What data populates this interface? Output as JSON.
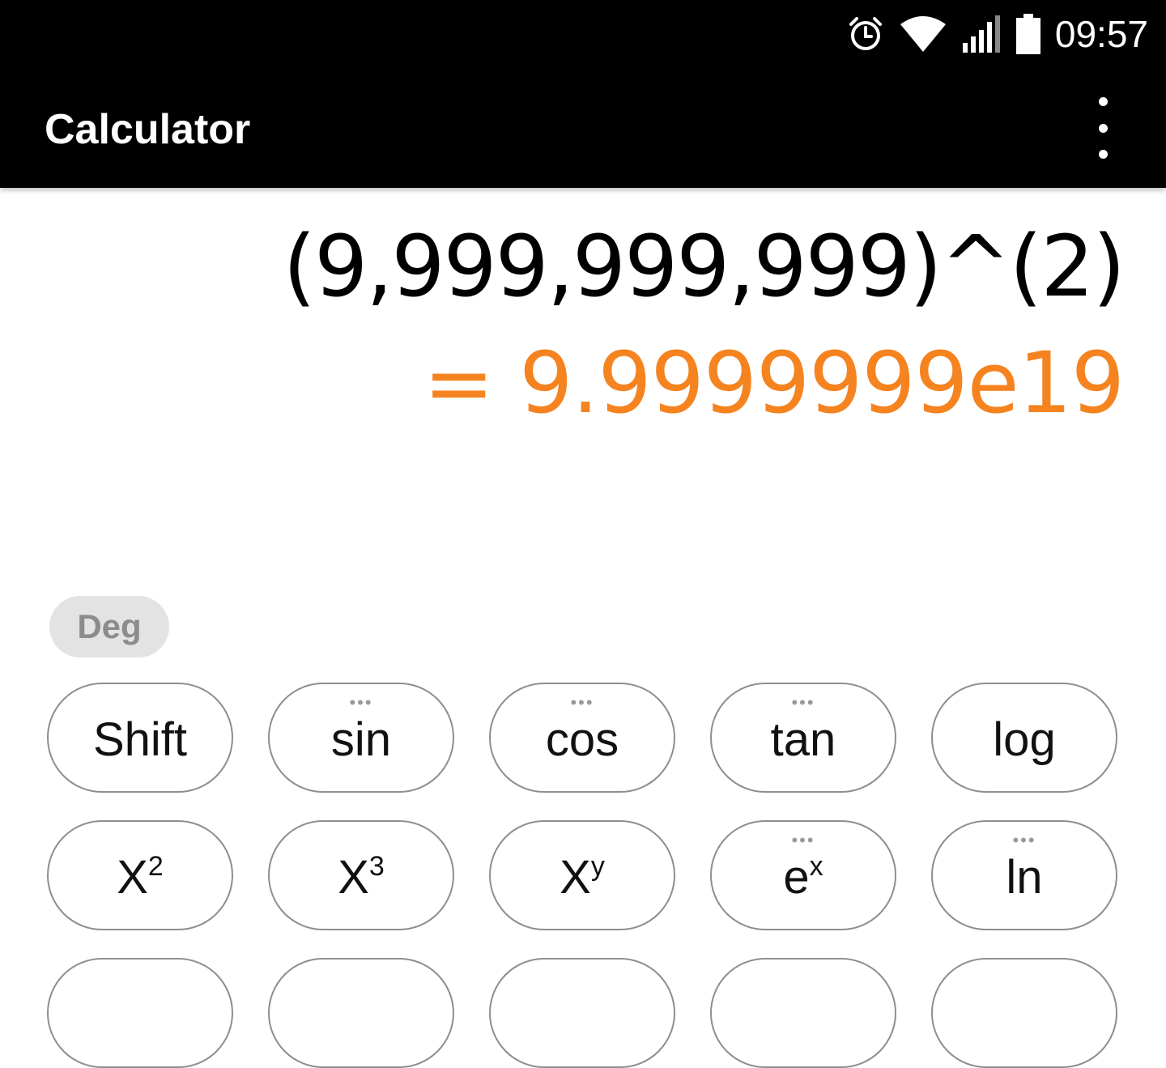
{
  "status_bar": {
    "time": "09:57",
    "icons": [
      "alarm-icon",
      "wifi-icon",
      "signal-icon",
      "battery-icon"
    ]
  },
  "app_bar": {
    "title": "Calculator",
    "menu_icon": "more-vert-icon"
  },
  "display": {
    "expression": "(9,999,999,999)^(2)",
    "result": "= 9.9999999e19",
    "result_color": "#f5831f"
  },
  "angle_mode": "Deg",
  "keypad": {
    "row1": [
      {
        "label": "Shift",
        "more": false
      },
      {
        "label": "sin",
        "more": true
      },
      {
        "label": "cos",
        "more": true
      },
      {
        "label": "tan",
        "more": true
      },
      {
        "label": "log",
        "more": false
      }
    ],
    "row2": [
      {
        "base": "X",
        "sup": "2",
        "more": false
      },
      {
        "base": "X",
        "sup": "3",
        "more": false
      },
      {
        "base": "X",
        "sup": "y",
        "more": false
      },
      {
        "base": "e",
        "sup": "x",
        "more": true
      },
      {
        "base": "ln",
        "sup": "",
        "more": true
      }
    ],
    "more_indicator": "•••"
  }
}
